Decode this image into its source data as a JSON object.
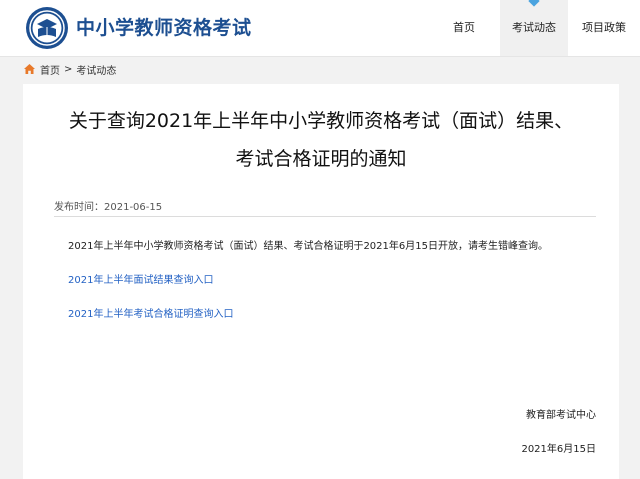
{
  "header": {
    "site_title": "中小学教师资格考试",
    "logo_icon": "education-emblem-icon",
    "nav": [
      {
        "label": "首页"
      },
      {
        "label": "考试动态",
        "active": true
      },
      {
        "label": "项目政策"
      }
    ]
  },
  "breadcrumb": {
    "icon": "home-icon",
    "home": "首页",
    "separator": ">",
    "current": "考试动态"
  },
  "article": {
    "title_line1": "关于查询2021年上半年中小学教师资格考试（面试）结果、",
    "title_line2": "考试合格证明的通知",
    "publish_label": "发布时间：",
    "publish_date": "2021-06-15",
    "body": "2021年上半年中小学教师资格考试（面试）结果、考试合格证明于2021年6月15日开放，请考生错峰查询。",
    "links": [
      {
        "label": "2021年上半年面试结果查询入口"
      },
      {
        "label": "2021年上半年考试合格证明查询入口"
      }
    ],
    "signature_org": "教育部考试中心",
    "signature_date": "2021年6月15日"
  },
  "colors": {
    "brand": "#1d4f91",
    "link": "#2462c4",
    "nav_marker": "#4aa3df",
    "home_icon": "#e8792a",
    "page_bg": "#f2f2f2"
  }
}
